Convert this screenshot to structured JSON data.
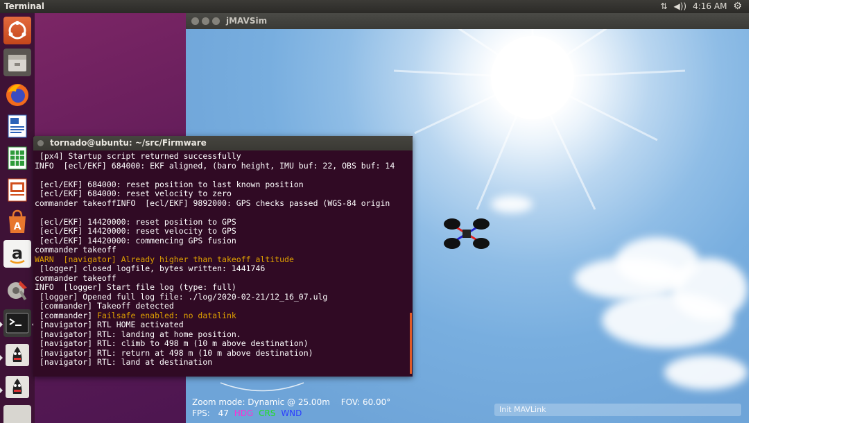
{
  "topbar": {
    "title": "Terminal",
    "network_icon": "⇅",
    "sound_icon": "◀))",
    "time": "4:16 AM",
    "settings_icon": "⚙"
  },
  "launcher": {
    "items": [
      {
        "name": "ubuntu-dash-icon"
      },
      {
        "name": "files-icon"
      },
      {
        "name": "firefox-icon"
      },
      {
        "name": "writer-icon"
      },
      {
        "name": "calc-icon"
      },
      {
        "name": "impress-icon"
      },
      {
        "name": "software-center-icon"
      },
      {
        "name": "amazon-icon"
      },
      {
        "name": "system-settings-icon"
      },
      {
        "name": "terminal-icon"
      },
      {
        "name": "java-app-icon"
      },
      {
        "name": "java-app-icon-2"
      }
    ],
    "amazon_letter": "a"
  },
  "sim": {
    "title": "jMAVSim",
    "hud_zoom": "Zoom mode: Dynamic @ 25.00m",
    "hud_fov": "FOV: 60.00°",
    "hud_fps_label": "FPS:",
    "hud_fps_value": "47",
    "hud_hdg": "HDG",
    "hud_crs": "CRS",
    "hud_wnd": "WND",
    "hud_colors": {
      "hdg": "#ff2bd6",
      "crs": "#20e020",
      "wnd": "#2a3cff"
    },
    "status": "Init MAVLink"
  },
  "terminal": {
    "title": "tornado@ubuntu: ~/src/Firmware",
    "lines": [
      {
        "text": " [px4] Startup script returned successfully",
        "warn": false
      },
      {
        "text": "INFO  [ecl/EKF] 684000: EKF aligned, (baro height, IMU buf: 22, OBS buf: 14",
        "warn": false
      },
      {
        "text": "",
        "warn": false
      },
      {
        "text": " [ecl/EKF] 684000: reset position to last known position",
        "warn": false
      },
      {
        "text": " [ecl/EKF] 684000: reset velocity to zero",
        "warn": false
      },
      {
        "text": "commander takeoffINFO  [ecl/EKF] 9892000: GPS checks passed (WGS-84 origin",
        "warn": false
      },
      {
        "text": "",
        "warn": false
      },
      {
        "text": " [ecl/EKF] 14420000: reset position to GPS",
        "warn": false
      },
      {
        "text": " [ecl/EKF] 14420000: reset velocity to GPS",
        "warn": false
      },
      {
        "text": " [ecl/EKF] 14420000: commencing GPS fusion",
        "warn": false
      },
      {
        "text": "commander takeoff",
        "warn": false
      },
      {
        "text": "WARN  [navigator] Already higher than takeoff altitude",
        "warn": true
      },
      {
        "text": " [logger] closed logfile, bytes written: 1441746",
        "warn": false
      },
      {
        "text": "commander takeoff",
        "warn": false
      },
      {
        "text": "INFO  [logger] Start file log (type: full)",
        "warn": false
      },
      {
        "text": " [logger] Opened full log file: ./log/2020-02-21/12_16_07.ulg",
        "warn": false
      },
      {
        "text": " [commander] Takeoff detected",
        "warn": false
      },
      {
        "text": " [commander] Failsafe enabled: no datalink",
        "warn": true,
        "warn_from": 12
      },
      {
        "text": " [navigator] RTL HOME activated",
        "warn": false
      },
      {
        "text": " [navigator] RTL: landing at home position.",
        "warn": false
      },
      {
        "text": " [navigator] RTL: climb to 498 m (10 m above destination)",
        "warn": false
      },
      {
        "text": " [navigator] RTL: return at 498 m (10 m above destination)",
        "warn": false
      },
      {
        "text": " [navigator] RTL: land at destination",
        "warn": false
      }
    ]
  }
}
